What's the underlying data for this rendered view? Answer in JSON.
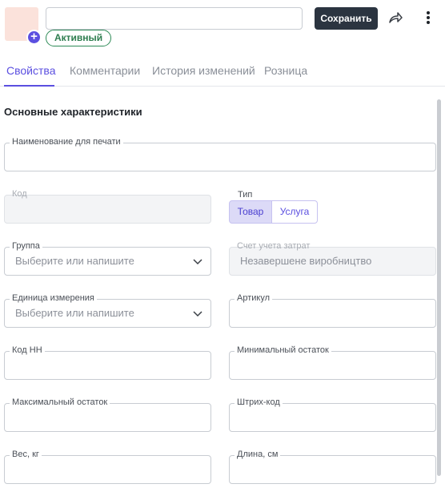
{
  "header": {
    "name_value": "",
    "status": "Активный",
    "save_label": "Сохранить",
    "icons": {
      "add_photo": "plus-icon",
      "share": "share-icon",
      "more": "more-vertical-icon"
    },
    "colors": {
      "accent": "#5b4fe0",
      "save_button": "#2b3440",
      "status": "#2e7d4f"
    }
  },
  "tabs": [
    {
      "label": "Свойства",
      "active": true
    },
    {
      "label": "Комментарии",
      "active": false
    },
    {
      "label": "История изменений",
      "active": false
    },
    {
      "label": "Розница",
      "active": false
    }
  ],
  "section": {
    "title": "Основные характеристики"
  },
  "fields": {
    "print_name": {
      "label": "Наименование для печати",
      "value": ""
    },
    "code": {
      "label": "Код",
      "value": ""
    },
    "type": {
      "label": "Тип",
      "options": [
        "Товар",
        "Услуга"
      ],
      "selected": "Товар"
    },
    "group": {
      "label": "Группа",
      "placeholder": "Выберите или напишите"
    },
    "cost_account": {
      "label": "Счет учета затрат",
      "value": "Незавершене виробництво"
    },
    "unit": {
      "label": "Единица измерения",
      "placeholder": "Выберите или напишите"
    },
    "article": {
      "label": "Артикул",
      "value": ""
    },
    "code_nn": {
      "label": "Код НН",
      "value": ""
    },
    "min_stock": {
      "label": "Минимальный остаток",
      "value": ""
    },
    "max_stock": {
      "label": "Максимальный остаток",
      "value": ""
    },
    "barcode": {
      "label": "Штрих-код",
      "value": ""
    },
    "weight": {
      "label": "Вес, кг",
      "value": ""
    },
    "length": {
      "label": "Длина, см",
      "value": ""
    }
  }
}
